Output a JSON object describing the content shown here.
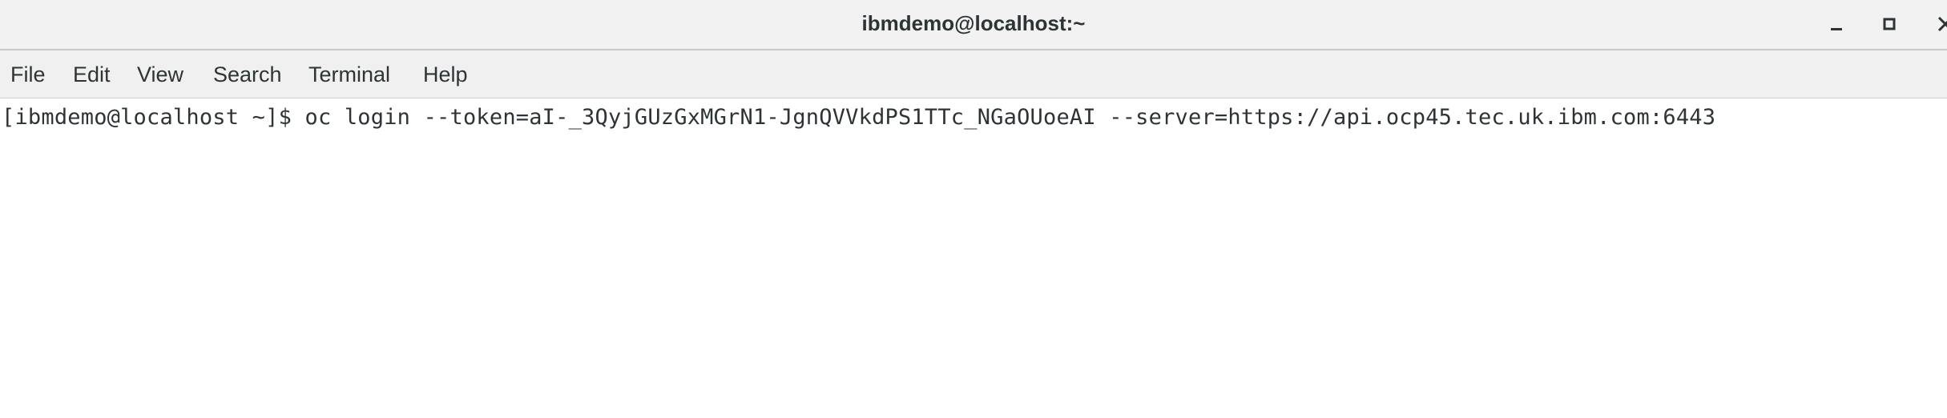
{
  "window": {
    "title": "ibmdemo@localhost:~"
  },
  "menu": {
    "items": [
      {
        "label": "File"
      },
      {
        "label": "Edit"
      },
      {
        "label": "View"
      },
      {
        "label": "Search"
      },
      {
        "label": "Terminal"
      },
      {
        "label": "Help"
      }
    ]
  },
  "terminal": {
    "lines": [
      {
        "prompt": "[ibmdemo@localhost ~]$ ",
        "command": "oc login --token=aI-_3QyjGUzGxMGrN1-JgnQVVkdPS1TTc_NGaOUoeAI --server=https://api.ocp45.tec.uk.ibm.com:6443"
      }
    ]
  },
  "icons": {
    "minimize": "minimize-icon",
    "maximize": "maximize-icon",
    "close": "close-icon"
  },
  "colors": {
    "titlebar_bg": "#f2f2f2",
    "menubar_bg": "#f0f0f0",
    "text": "#2e3436",
    "terminal_bg": "#ffffff"
  }
}
